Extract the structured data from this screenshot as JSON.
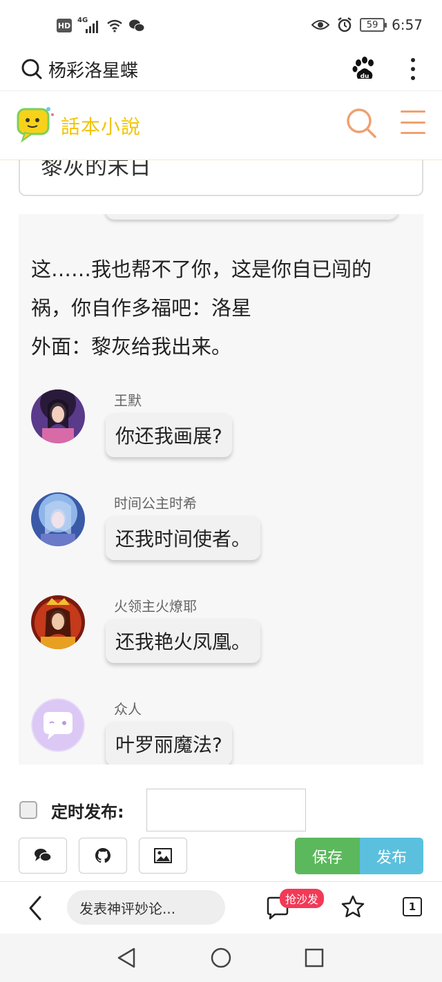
{
  "status_bar": {
    "hd": "HD",
    "network": "4G",
    "battery": "59",
    "time": "6:57",
    "icons": [
      "hd-icon",
      "signal-icon",
      "wifi-icon",
      "wechat-icon",
      "eye-icon",
      "alarm-icon",
      "battery-icon"
    ]
  },
  "search_header": {
    "query": "杨彩洛星蝶",
    "icons": [
      "search-icon",
      "baidu-icon",
      "more-vertical-icon"
    ]
  },
  "site_header": {
    "logo_text": "話本小說",
    "accent_color": "#f0a070",
    "icons": [
      "site-search-icon",
      "menu-icon"
    ]
  },
  "article": {
    "title": "黎灰的末日",
    "narration": [
      "这……我也帮不了你，这是你自已闯的",
      "祸，你自作多福吧：洛星",
      "外面：黎灰给我出来。"
    ],
    "messages": [
      {
        "name": "王默",
        "text": "你还我画展?"
      },
      {
        "name": "时间公主时希",
        "text": "还我时间使者。"
      },
      {
        "name": "火领主火燎耶",
        "text": "还我艳火凤凰。"
      },
      {
        "name": "众人",
        "text": "叶罗丽魔法?"
      }
    ]
  },
  "publish": {
    "schedule_label": "定时发布:",
    "schedule_value": "",
    "save_label": "保存",
    "publish_label": "发布",
    "save_color": "#5cb85c",
    "publish_color": "#5bc0de",
    "tool_icons": [
      "chat-icon",
      "github-icon",
      "image-icon"
    ]
  },
  "bottom_bar": {
    "comment_placeholder": "发表神评妙论...",
    "sofa_badge": "抢沙发",
    "tab_count": "1",
    "icons": [
      "back-icon",
      "comment-icon",
      "star-icon",
      "tabs-icon"
    ]
  },
  "nav_bar": {
    "icons": [
      "nav-back-icon",
      "nav-home-icon",
      "nav-recents-icon"
    ]
  }
}
